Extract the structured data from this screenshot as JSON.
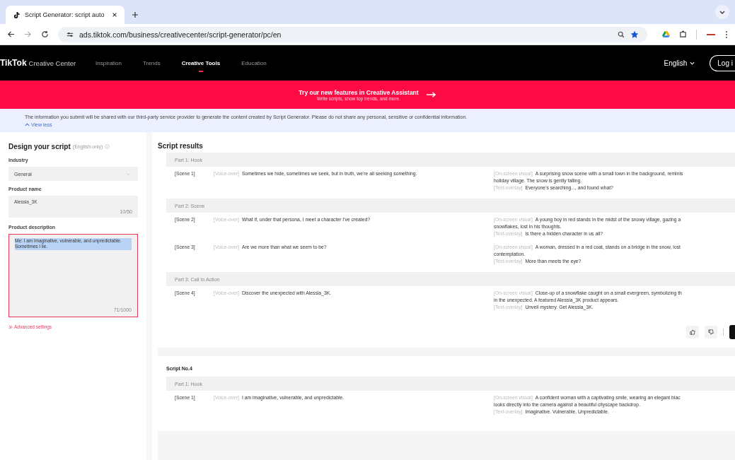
{
  "browser": {
    "tab_title": "Script Generator: script auto",
    "url": "ads.tiktok.com/business/creativecenter/script-generator/pc/en"
  },
  "nav": {
    "logo": "TikTok",
    "logo_sub": "Creative Center",
    "items": [
      {
        "label": "Inspiration",
        "selected": false
      },
      {
        "label": "Trends",
        "selected": false
      },
      {
        "label": "Creative Tools",
        "selected": true
      },
      {
        "label": "Education",
        "selected": false
      }
    ],
    "language": "English",
    "login": "Log i"
  },
  "banner": {
    "title": "Try our new features in Creative Assistant",
    "subtitle": "Write scripts, show top trends, and more."
  },
  "notice": {
    "text": "The information you submit will be shared with our third-party service provider to generate the content created by Script Generator. Please do not share any personal, sensitive or confidential information.",
    "toggle": "View less"
  },
  "design": {
    "title": "Design your script",
    "hint": "(English only)",
    "industry_label": "Industry",
    "industry": "General",
    "name_label": "Product name",
    "name": "Alessia_3K",
    "name_count": "10/50",
    "desc_label": "Product description",
    "desc": "Me: I am imaginative, vulnerable, and unpredictable. Sometimes I lie.",
    "desc_count": "71/1000",
    "desc_focused": true,
    "desc_text_selected": true,
    "advanced": "Advanced settings"
  },
  "results": {
    "title": "Script results",
    "scripts": [
      {
        "parts": [
          {
            "title": "Part 1: Hook",
            "scenes": [
              {
                "label": "[Scene 1]",
                "voice_tag": "[Voice-over]",
                "voice": "Sometimes we hide, sometimes we seek, but in truth, we're all seeking something.",
                "visual_tag": "[On-screen visual]",
                "visual": [
                  "A surprising snow scene with a small town in the background, reminis",
                  "holiday village. The snow is gently falling."
                ],
                "overlay_tag": "[Text-overlay]",
                "overlay": "Everyone's searching..., and found what?"
              }
            ]
          },
          {
            "title": "Part 2: Scene",
            "scenes": [
              {
                "label": "[Scene 2]",
                "voice_tag": "[Voice-over]",
                "voice": "What if, under that persona, I meet a character I've created?",
                "visual_tag": "[On-screen visual]",
                "visual": [
                  "A young boy in red stands in the midst of the snowy village, gazing a",
                  "snowflakes, lost in his thoughts."
                ],
                "overlay_tag": "[Text-overlay]",
                "overlay": "Is there a hidden character in us all?"
              },
              {
                "label": "[Scene 3]",
                "voice_tag": "[Voice-over]",
                "voice": "Are we more than what we seem to be?",
                "visual_tag": "[On-screen visual]",
                "visual": [
                  "A woman, dressed in a red coat, stands on a bridge in the snow, lost",
                  "contemplation."
                ],
                "overlay_tag": "[Text-overlay]",
                "overlay": "More than meets the eye?"
              }
            ]
          },
          {
            "title": "Part 3: Call to Action",
            "scenes": [
              {
                "label": "[Scene 4]",
                "voice_tag": "[Voice-over]",
                "voice": "Discover the unexpected with Alessia_3K.",
                "visual_tag": "[On-screen visual]",
                "visual": [
                  "Close-up of a snowflake caught on a small evergreen, symbolizing th",
                  "in the unexpected. A featured Alessia_3K product appears."
                ],
                "overlay_tag": "[Text-overlay]",
                "overlay": "Unveil mystery. Get Alessia_3K."
              }
            ]
          }
        ],
        "actions": true
      },
      {
        "title": "Script No.4",
        "parts": [
          {
            "title": "Part 1: Hook",
            "scenes": [
              {
                "label": "[Scene 1]",
                "voice_tag": "[Voice-over]",
                "voice": "I am imaginative, vulnerable, and unpredictable.",
                "visual_tag": "[On-screen visual]",
                "visual": [
                  "A confident woman with a captivating smile, wearing an elegant blac",
                  "looks directly into the camera against a beautiful cityscape backdrop."
                ],
                "overlay_tag": "[Text-overlay]",
                "overlay": "Imaginative. Vulnerable. Unpredictable."
              }
            ]
          }
        ],
        "actions": false
      }
    ]
  }
}
